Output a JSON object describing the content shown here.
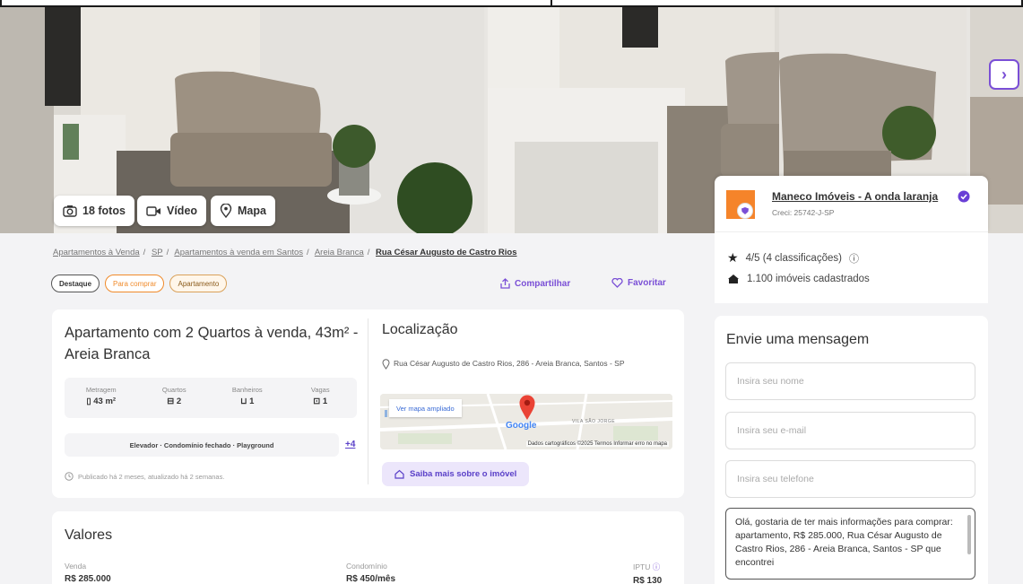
{
  "gallery": {
    "photos_label": "18 fotos",
    "video_label": "Vídeo",
    "map_label": "Mapa",
    "next_label": "›"
  },
  "breadcrumb": [
    "Apartamentos à Venda",
    "SP",
    "Apartamentos à venda em Santos",
    "Areia Branca",
    "Rua César Augusto de Castro Rios"
  ],
  "tags": [
    "Destaque",
    "Para comprar",
    "Apartamento"
  ],
  "actions": {
    "share": "Compartilhar",
    "favorite": "Favoritar"
  },
  "listing": {
    "title": "Apartamento com 2 Quartos à venda, 43m² - Areia Branca",
    "stats": [
      {
        "label": "Metragem",
        "value": "43 m²"
      },
      {
        "label": "Quartos",
        "value": "2"
      },
      {
        "label": "Banheiros",
        "value": "1"
      },
      {
        "label": "Vagas",
        "value": "1"
      }
    ],
    "amenities": "Elevador · Condomínio fechado · Playground",
    "amenities_more": "+4",
    "published": "Publicado há 2 meses, atualizado há 2 semanas."
  },
  "location": {
    "title": "Localização",
    "address": "Rua César Augusto de Castro Rios, 286 - Areia Branca, Santos - SP",
    "map_link": "Ver mapa ampliado",
    "map_brand": "Google",
    "map_area": "VILA SÃO JORGE",
    "map_footer": "Dados cartográficos ©2025   Termos   Informar erro no mapa",
    "more_button": "Saiba mais sobre o imóvel"
  },
  "values": {
    "title": "Valores",
    "items": [
      {
        "label": "Venda",
        "value": "R$ 285.000"
      },
      {
        "label": "Condomínio",
        "value": "R$ 450/mês"
      },
      {
        "label": "IPTU",
        "value": "R$ 130"
      }
    ]
  },
  "agent": {
    "name": "Maneco Imóveis - A onda laranja",
    "creci": "Creci: 25742-J-SP",
    "rating": "4/5 (4 classificações)",
    "listings": "1.100 imóveis cadastrados"
  },
  "message": {
    "title": "Envie uma mensagem",
    "name_placeholder": "Insira seu nome",
    "email_placeholder": "Insira seu e-mail",
    "phone_placeholder": "Insira seu telefone",
    "text": "Olá, gostaria de ter mais informações para comprar: apartamento, R$ 285.000, Rua César Augusto de Castro Rios, 286 - Areia Branca, Santos - SP que encontrei"
  },
  "colors": {
    "accent": "#7a4fd6",
    "brand_orange": "#f5842a"
  }
}
